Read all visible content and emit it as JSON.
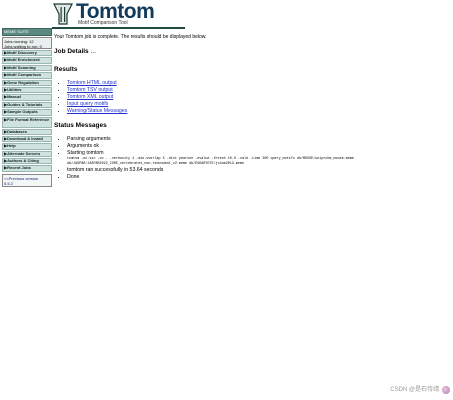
{
  "header": {
    "title": "Tomtom",
    "subtitle": "Motif Comparison Tool"
  },
  "sidebar": {
    "top_label": "MEME SUITE",
    "status": {
      "line1": "Jobs running: 12",
      "line2": "Jobs waiting to run: 0"
    },
    "items": [
      {
        "label": "▶Motif Discovery"
      },
      {
        "label": "▶Motif Enrichment"
      },
      {
        "label": "▶Motif Scanning"
      },
      {
        "label": "▶Motif Comparison"
      },
      {
        "label": "▶Gene Regulation"
      },
      {
        "label": "▶Utilities"
      },
      {
        "label": "▶Manual"
      },
      {
        "label": "▶Guides & Tutorials"
      },
      {
        "label": "▶Sample Outputs"
      },
      {
        "label": "▶File Format Reference",
        "tall": true
      },
      {
        "label": "▶Databases"
      },
      {
        "label": "▶Download & Install"
      },
      {
        "label": "▶Help"
      },
      {
        "label": "▶Alternate Servers"
      },
      {
        "label": "▶Authors & Citing"
      },
      {
        "label": "▶Recent Jobs"
      }
    ],
    "previous_version": {
      "line1": "<<Previous version",
      "line2": "5.5.2"
    }
  },
  "main": {
    "intro": "Your Tomtom job is complete. The results should be displayed below.",
    "job_details_heading": "Job Details",
    "job_details_suffix": "...",
    "results_heading": "Results",
    "results": [
      "Tomtom HTML output",
      "Tomtom TSV output",
      "Tomtom XML output",
      "Input query motifs",
      "Warning/Status Messages"
    ],
    "status_heading": "Status Messages",
    "status": {
      "s1": "Parsing arguments",
      "s2": "Arguments ok",
      "s3": "Starting tomtom",
      "command": "tomtom -no-ssc -oc . -verbosity 1 -min-overlap 5 -dist pearson -evalue -thresh 10.0 -vald -time 300 query_motifs db/MOUSE/uniprobe_mouse.meme db/JASPAR/JASPAR2022_CORE_vertebrates_non-redundant_v2.meme db/EUKARYOTE/jolma2013.meme",
      "s4": "tomtom ran successfully in 53.64 seconds",
      "s5": "Done"
    }
  },
  "watermark": "CSDN @是石侍靖"
}
